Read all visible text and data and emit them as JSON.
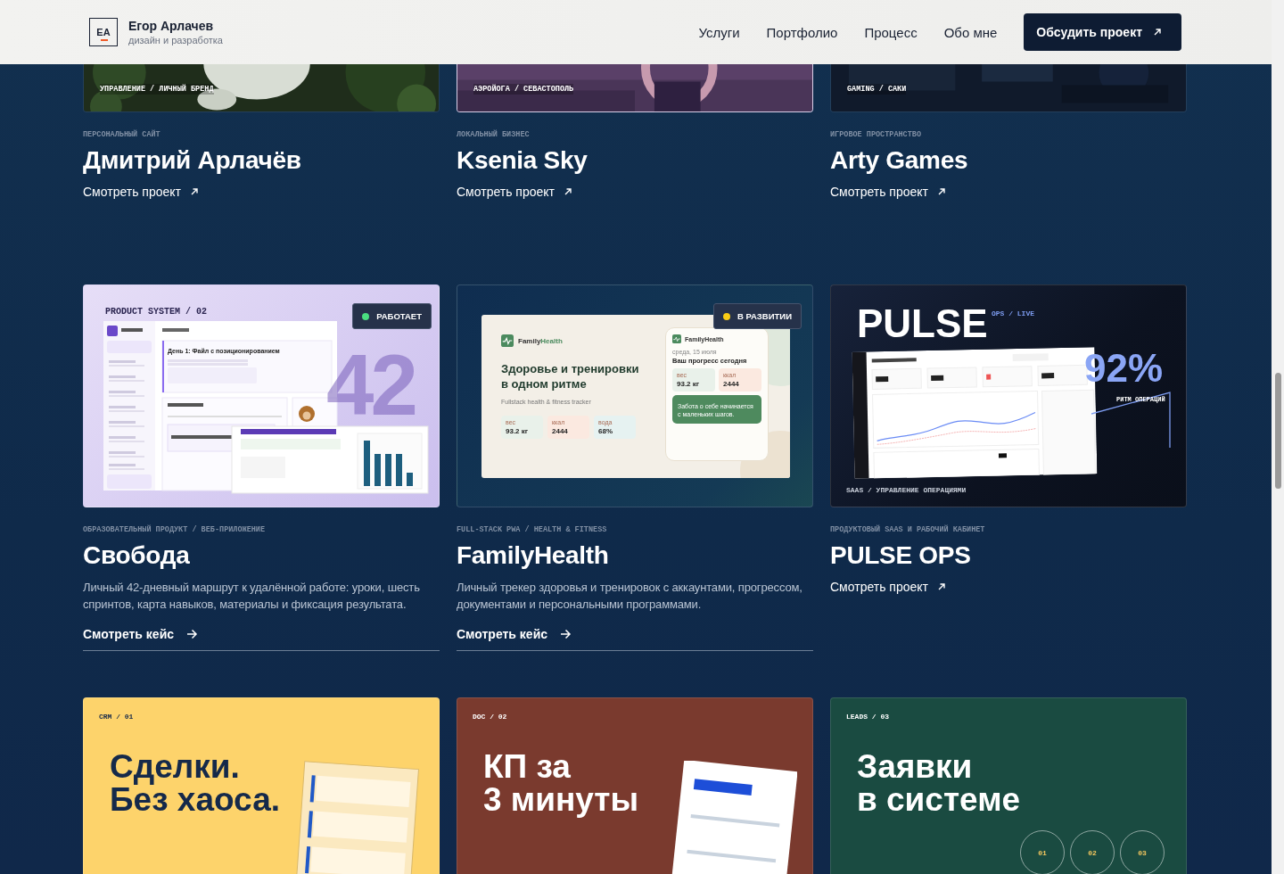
{
  "header": {
    "logo_mark": "EA",
    "name": "Егор Арлачев",
    "tagline": "дизайн и разработка",
    "nav": [
      "Услуги",
      "Портфолио",
      "Процесс",
      "Обо мне"
    ],
    "cta": "Обсудить проект"
  },
  "top_projects": [
    {
      "tag": "УПРАВЛЕНИЕ / ЛИЧНЫЙ БРЕНД",
      "category": "ПЕРСОНАЛЬНЫЙ САЙТ",
      "title": "Дмитрий Арлачёв",
      "link": "Смотреть проект",
      "highlighted": false
    },
    {
      "tag": "АЭРОЙОГА / СЕВАСТОПОЛЬ",
      "category": "ЛОКАЛЬНЫЙ БИЗНЕС",
      "title": "Ksenia Sky",
      "link": "Смотреть проект",
      "highlighted": true
    },
    {
      "tag": "GAMING / САКИ",
      "category": "ИГРОВОЕ ПРОСТРАНСТВО",
      "title": "Arty Games",
      "link": "Смотреть проект",
      "highlighted": false
    }
  ],
  "cases": [
    {
      "kind": "product_system",
      "category": "ОБРАЗОВАТЕЛЬНЫЙ ПРОДУКТ / ВЕБ-ПРИЛОЖЕНИЕ",
      "title": "Свобода",
      "description": "Личный 42-дневный маршрут к удалённой работе: уроки, шесть спринтов, карта навыков, материалы и фиксация результата.",
      "link": "Смотреть кейс",
      "preview": {
        "label": "PRODUCT SYSTEM / 02",
        "big_number": "42",
        "lesson": "День 1: Файл с позиционированием",
        "status": {
          "label": "РАБОТАЕТ",
          "color": "#4ade80"
        }
      }
    },
    {
      "kind": "family_health",
      "category": "FULL-STACK PWA / HEALTH & FITNESS",
      "title": "FamilyHealth",
      "description": "Личный трекер здоровья и тренировок с аккаунтами, прогрессом, документами и персональными программами.",
      "link": "Смотреть кейс",
      "preview": {
        "status": {
          "label": "В РАЗВИТИИ",
          "color": "#facc15"
        },
        "brand": "Family",
        "brand_accent": "Health",
        "headline": "Здоровье и тренировки в одном ритме",
        "subtitle": "Fullstack health & fitness tracker",
        "stats": [
          {
            "label": "вес",
            "value": "93.2 кг",
            "color": "#e9f1ea"
          },
          {
            "label": "ккал",
            "value": "2444",
            "color": "#fbe9e0"
          },
          {
            "label": "вода",
            "value": "68%",
            "color": "#e6f2f1"
          }
        ],
        "phone_brand": "FamilyHealth",
        "date": "среда, 15 июля",
        "phone_title": "Ваш прогресс сегодня",
        "phone_stats": [
          {
            "label": "вес",
            "value": "93.2 кг",
            "color": "#e9f1ea"
          },
          {
            "label": "ккал",
            "value": "2444",
            "color": "#fbe9e0"
          }
        ],
        "quote": "Забота о себе начинается с маленьких шагов."
      }
    },
    {
      "kind": "pulse",
      "category": "ПРОДУКТОВЫЙ SAAS И РАБОЧИЙ КАБИНЕТ",
      "title": "PULSE OPS",
      "link": "Смотреть проект",
      "preview": {
        "logo": "PULSE",
        "sublabel": "OPS / LIVE",
        "metric": "92%",
        "metric_label": "РИТМ ОПЕРАЦИЙ",
        "tag": "SAAS / УПРАВЛЕНИЕ ОПЕРАЦИЯМИ"
      }
    }
  ],
  "services": [
    {
      "kind": "crm",
      "tag": "CRM / 01",
      "headline": [
        "Сделки.",
        "Без хаоса."
      ],
      "color": "#fdd36b"
    },
    {
      "kind": "doc",
      "tag": "DOC / 02",
      "headline": [
        "КП за",
        "3 минуты"
      ],
      "color": "#7a3a2e"
    },
    {
      "kind": "leads",
      "tag": "LEADS / 03",
      "headline": [
        "Заявки",
        "в системе"
      ],
      "color": "#1a4b41",
      "steps": [
        "01",
        "02",
        "03"
      ]
    }
  ]
}
